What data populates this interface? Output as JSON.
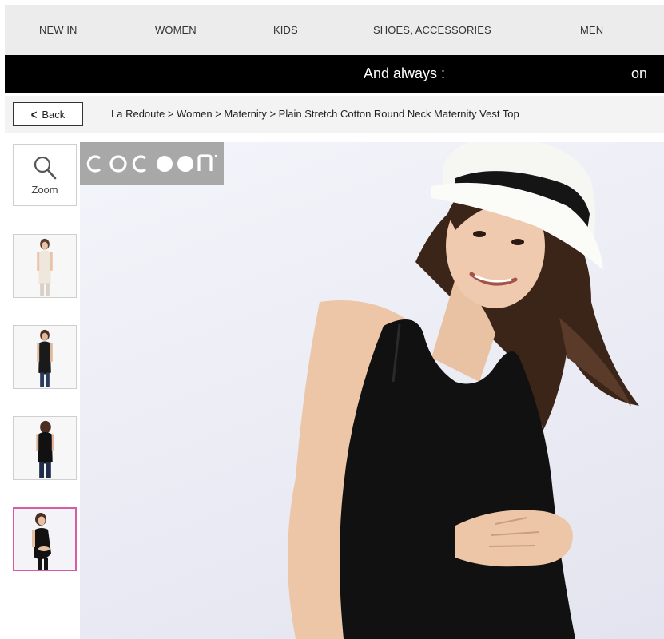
{
  "nav": {
    "items": [
      "NEW IN",
      "WOMEN",
      "KIDS",
      "SHOES, ACCESSORIES",
      "MEN"
    ]
  },
  "promo": {
    "text": "And always :",
    "trailing": "on"
  },
  "breadcrumb": {
    "back_label": "Back",
    "path": "La Redoute > Women > Maternity > Plain Stretch Cotton Round Neck Maternity Vest Top"
  },
  "gallery": {
    "zoom_label": "Zoom",
    "brand_logo": "cocoon",
    "selected_thumbnail": 4,
    "active_border_color": "#d65ca6"
  }
}
